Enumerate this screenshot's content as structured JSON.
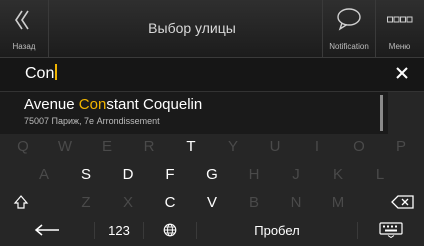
{
  "header": {
    "back_label": "Назад",
    "title": "Выбор улицы",
    "notification_label": "Notification",
    "menu_label": "Меню"
  },
  "search": {
    "value": "Con"
  },
  "suggestions": [
    {
      "match": "Con",
      "main_prefix": "Avenue ",
      "main_suffix": "stant Coquelin",
      "sub": "75007 Париж, 7е Arrondissement"
    }
  ],
  "keyboard": {
    "row1": [
      "Q",
      "W",
      "E",
      "R",
      "T",
      "Y",
      "U",
      "I",
      "O",
      "P"
    ],
    "row1_enabled": [
      "T"
    ],
    "row2": [
      "A",
      "S",
      "D",
      "F",
      "G",
      "H",
      "J",
      "K",
      "L"
    ],
    "row2_enabled": [
      "S",
      "D",
      "F",
      "G"
    ],
    "row3": [
      "Z",
      "X",
      "C",
      "V",
      "B",
      "N",
      "M"
    ],
    "row3_enabled": [
      "C",
      "V"
    ],
    "numbers_label": "123",
    "space_label": "Пробел"
  },
  "colors": {
    "accent": "#f0b400",
    "background": "#1e1e1e"
  }
}
